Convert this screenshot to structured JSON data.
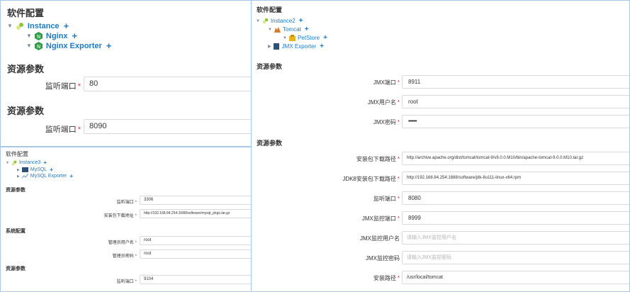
{
  "p1": {
    "title": "软件配置",
    "tree": {
      "root": "Instance",
      "children": [
        "Nginx",
        "Nginx Exporter"
      ]
    },
    "sections": [
      {
        "title": "资源参数",
        "fields": [
          {
            "label": "监听端口",
            "value": "80"
          }
        ]
      },
      {
        "title": "资源参数",
        "fields": [
          {
            "label": "监听端口",
            "value": "8090"
          }
        ]
      }
    ]
  },
  "p2": {
    "title": "软件配置",
    "tree": {
      "root": "Instance3",
      "children": [
        "MySQL",
        "MySQL Exporter"
      ]
    },
    "s1": {
      "title": "资源参数",
      "fields": [
        {
          "label": "监听端口",
          "value": "3306"
        },
        {
          "label": "安装包下载地址",
          "value": "http://192.168.84.254:1688/software/mysql_pkgs.tar.gz"
        }
      ]
    },
    "s2": {
      "title": "系统配置",
      "fields": [
        {
          "label": "管理员用户名",
          "value": "root"
        },
        {
          "label": "管理员密码",
          "value": "root"
        }
      ]
    },
    "s3": {
      "title": "资源参数",
      "fields": [
        {
          "label": "监听端口",
          "value": "9104"
        }
      ]
    }
  },
  "p3": {
    "title": "软件配置",
    "tree": {
      "root": "Instance2",
      "tomcat": "Tomcat",
      "petstore": "PetStore",
      "jmx": "JMX Exporter"
    },
    "s1": {
      "title": "资源参数",
      "fields": [
        {
          "label": "JMX端口",
          "value": "8911",
          "placeholder": ""
        },
        {
          "label": "JMX用户名",
          "value": "root",
          "placeholder": ""
        },
        {
          "label": "JMX密码",
          "value": "••••••••",
          "placeholder": ""
        }
      ]
    },
    "s2": {
      "title": "资源参数",
      "fields": [
        {
          "label": "安装包下载路径",
          "value": "http://archive.apache.org/dist/tomcat/tomcat-9/v9.0.0.M10/bin/apache-tomcat-9.0.0.M10.tar.gz",
          "placeholder": ""
        },
        {
          "label": "JDK8安装包下载路径",
          "value": "http://192.168.84.254:1688/software/jdk-8u111-linux-x64.rpm",
          "placeholder": ""
        },
        {
          "label": "监听端口",
          "value": "8080",
          "placeholder": ""
        },
        {
          "label": "JMX监控端口",
          "value": "8999",
          "placeholder": ""
        },
        {
          "label": "JMX监控用户名",
          "value": "",
          "placeholder": "请输入JMX监控用户名"
        },
        {
          "label": "JMX监控密码",
          "value": "",
          "placeholder": "请输入JMX监控密码"
        },
        {
          "label": "安装路径",
          "value": "/usr/local/tomcat",
          "placeholder": ""
        }
      ]
    }
  },
  "required_mark": "*",
  "add_symbol": "+",
  "colors": {
    "link": "#1b7ac7",
    "required": "#e0353b",
    "border": "#a9c7e8",
    "placeholder": "#b5b5b5"
  }
}
